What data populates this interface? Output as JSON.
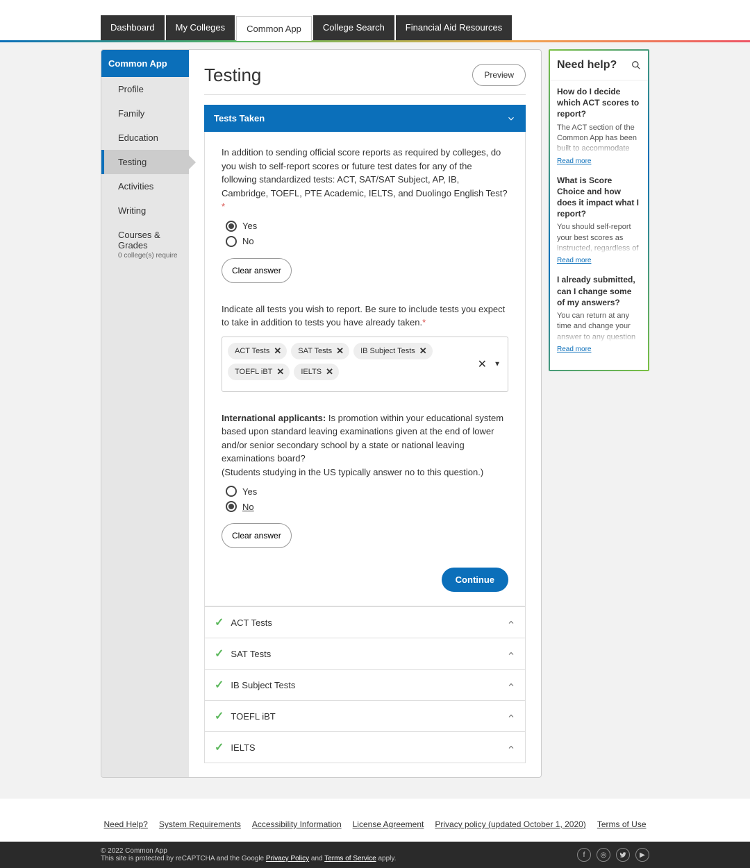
{
  "topbar": {
    "tabs": [
      "Dashboard",
      "My Colleges",
      "Common App",
      "College Search",
      "Financial Aid Resources"
    ],
    "active": 2
  },
  "sidebar": {
    "header": "Common App",
    "items": [
      {
        "label": "Profile"
      },
      {
        "label": "Family"
      },
      {
        "label": "Education"
      },
      {
        "label": "Testing",
        "active": true
      },
      {
        "label": "Activities"
      },
      {
        "label": "Writing"
      },
      {
        "label": "Courses & Grades",
        "sub": "0 college(s) require"
      }
    ]
  },
  "page": {
    "title": "Testing",
    "preview": "Preview"
  },
  "section": {
    "header": "Tests Taken"
  },
  "q1": {
    "text": "In addition to sending official score reports as required by colleges, do you wish to self-report scores or future test dates for any of the following standardized tests: ACT, SAT/SAT Subject, AP, IB, Cambridge, TOEFL, PTE Academic, IELTS, and Duolingo English Test?",
    "yes": "Yes",
    "no": "No",
    "selected": "yes",
    "clear": "Clear answer"
  },
  "q2": {
    "text": "Indicate all tests you wish to report. Be sure to include tests you expect to take in addition to tests you have already taken.",
    "chips": [
      "ACT Tests",
      "SAT Tests",
      "IB Subject Tests",
      "TOEFL iBT",
      "IELTS"
    ]
  },
  "q3": {
    "prefix": "International applicants:",
    "text": " Is promotion within your educational system based upon standard leaving examinations given at the end of lower and/or senior secondary school by a state or national leaving examinations board?",
    "note": "(Students studying in the US typically answer no to this question.)",
    "yes": "Yes",
    "no": "No",
    "selected": "no",
    "clear": "Clear answer"
  },
  "continue": "Continue",
  "accordions": [
    "ACT Tests",
    "SAT Tests",
    "IB Subject Tests",
    "TOEFL iBT",
    "IELTS"
  ],
  "help": {
    "title": "Need help?",
    "faqs": [
      {
        "q": "How do I decide which ACT scores to report?",
        "a": "The ACT section of the Common App has been built to accommodate current and previous",
        "more": "Read more"
      },
      {
        "q": "What is Score Choice and how does it impact what I report?",
        "a": "You should self-report your best scores as instructed, regardless of what individual colleges require",
        "more": "Read more"
      },
      {
        "q": "I already submitted, can I change some of my answers?",
        "a": "You can return at any time and change your answer to any question in the Common App tab for future",
        "more": "Read more"
      }
    ]
  },
  "footer": {
    "links": [
      "Need Help?",
      "System Requirements",
      "Accessibility Information",
      "License Agreement",
      "Privacy policy (updated October 1, 2020)",
      "Terms of Use"
    ],
    "copyright": "© 2022 Common App",
    "recaptcha_pre": "This site is protected by reCAPTCHA and the Google ",
    "privacy": "Privacy Policy",
    "and": " and ",
    "tos": "Terms of Service",
    "apply": " apply."
  }
}
